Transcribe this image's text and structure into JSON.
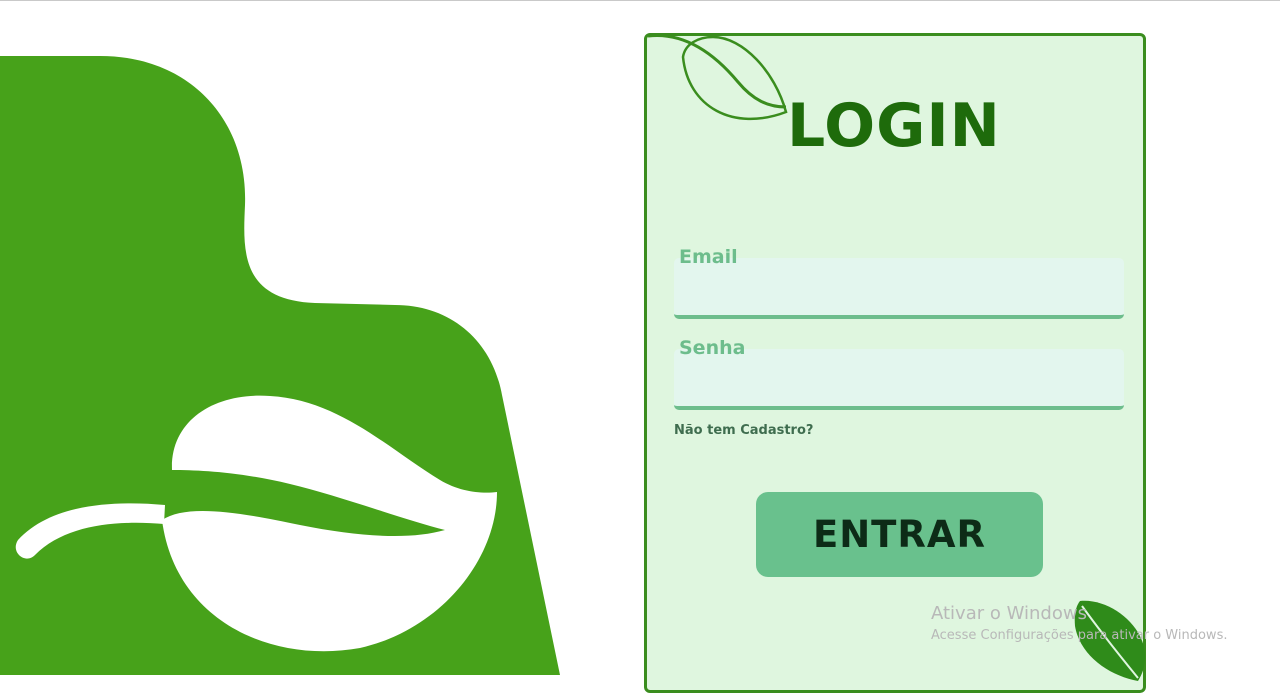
{
  "login": {
    "title": "LOGIN",
    "email_label": "Email",
    "email_value": "",
    "password_label": "Senha",
    "password_value": "",
    "signup_link": "Não tem Cadastro?",
    "submit_label": "ENTRAR"
  },
  "windows_watermark": {
    "title": "Ativar o Windows",
    "subtitle": "Acesse Configurações para ativar o Windows."
  },
  "colors": {
    "brand_green": "#47a21a",
    "card_background": "#dff6df",
    "card_border": "#3a8d1e",
    "title_green": "#1e6b0b",
    "accent_mint": "#69c18d"
  },
  "icons": {
    "hero": "leaf-icon",
    "card_corner": "leaf-outline-icon",
    "card_bottom": "leaf-icon"
  }
}
